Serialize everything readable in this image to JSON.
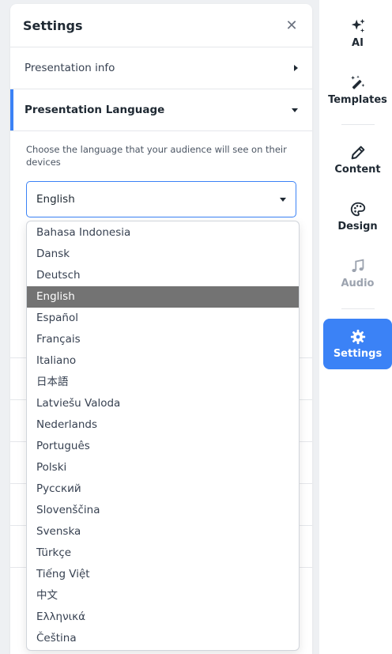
{
  "panel": {
    "title": "Settings",
    "close_icon": "close-icon",
    "sections": [
      {
        "label": "Presentation info",
        "icon": "caret-right-icon"
      },
      {
        "label": "Presentation Language",
        "icon": "caret-down-icon"
      }
    ],
    "language": {
      "description": "Choose the language that your audience will see on their devices",
      "selected": "English",
      "options": [
        "Bahasa Indonesia",
        "Dansk",
        "Deutsch",
        "English",
        "Español",
        "Français",
        "Italiano",
        "日本語",
        "Latviešu Valoda",
        "Nederlands",
        "Português",
        "Polski",
        "Русский",
        "Slovenščina",
        "Svenska",
        "Türkçe",
        "Tiếng Việt",
        "中文",
        "Ελληνικά",
        "Čeština"
      ]
    }
  },
  "rail": {
    "items": [
      {
        "label": "AI",
        "icon": "sparkles-icon"
      },
      {
        "label": "Templates",
        "icon": "magic-wand-icon"
      },
      {
        "label": "Content",
        "icon": "pencil-icon"
      },
      {
        "label": "Design",
        "icon": "palette-icon"
      },
      {
        "label": "Audio",
        "icon": "music-note-icon"
      },
      {
        "label": "Settings",
        "icon": "gear-icon"
      }
    ]
  },
  "colors": {
    "accent": "#3b82f6",
    "selected_option_bg": "#737373"
  }
}
